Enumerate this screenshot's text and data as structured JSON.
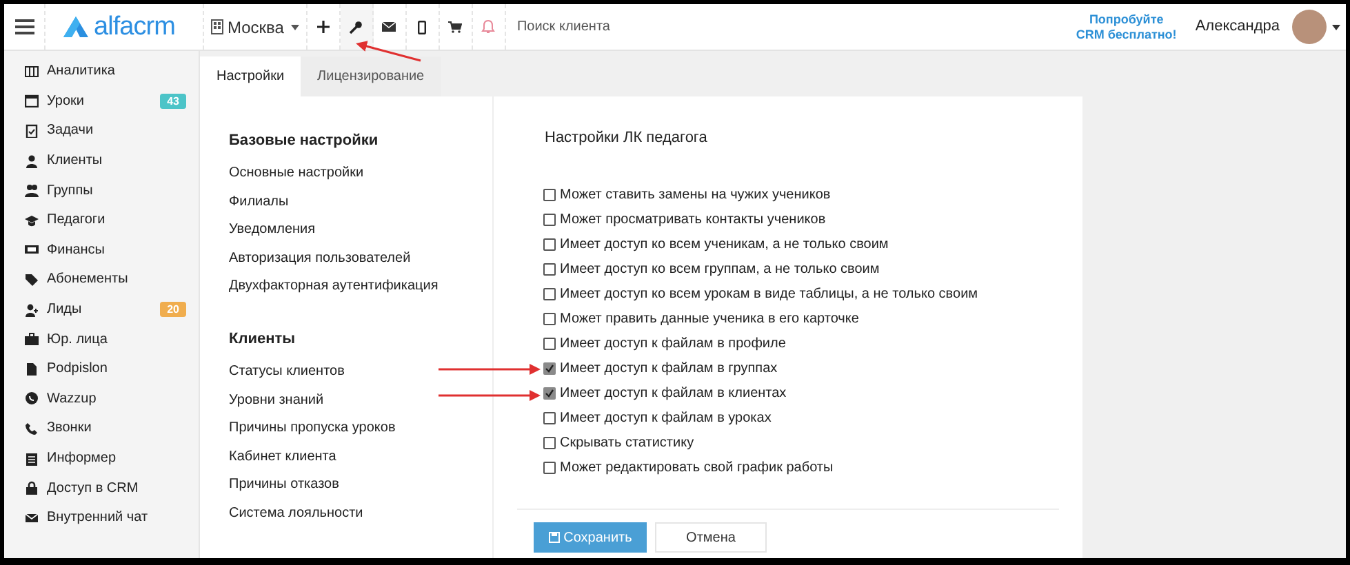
{
  "header": {
    "logo": "alfacrm",
    "branch": "Москва",
    "search": {
      "placeholder": "Поиск клиента"
    },
    "promo": "Попробуйте CRM бесплатно!",
    "user": "Александра"
  },
  "sidebar": {
    "items": [
      {
        "label": "Аналитика"
      },
      {
        "label": "Уроки",
        "badge": "43",
        "color": "#4cc4c8"
      },
      {
        "label": "Задачи"
      },
      {
        "label": "Клиенты"
      },
      {
        "label": "Группы"
      },
      {
        "label": "Педагоги"
      },
      {
        "label": "Финансы"
      },
      {
        "label": "Абонементы"
      },
      {
        "label": "Лиды",
        "badge": "20",
        "color": "#f0ad4e"
      },
      {
        "label": "Юр. лица"
      },
      {
        "label": "Podpislon"
      },
      {
        "label": "Wazzup"
      },
      {
        "label": "Звонки"
      },
      {
        "label": "Информер"
      },
      {
        "label": "Доступ в CRM"
      },
      {
        "label": "Внутренний чат"
      }
    ]
  },
  "tabs": [
    {
      "label": "Настройки",
      "selected": true
    },
    {
      "label": "Лицензирование",
      "selected": false
    }
  ],
  "settings_menu": {
    "sections": [
      {
        "title": "Базовые настройки",
        "items": [
          "Основные настройки",
          "Филиалы",
          "Уведомления",
          "Авторизация пользователей",
          "Двухфакторная аутентификация"
        ]
      },
      {
        "title": "Клиенты",
        "items": [
          "Статусы клиентов",
          "Уровни знаний",
          "Причины пропуска уроков",
          "Кабинет клиента",
          "Причины отказов",
          "Система лояльности"
        ]
      }
    ]
  },
  "teacher_settings": {
    "title": "Настройки ЛК педагога",
    "options": [
      {
        "label": "Может ставить замены на чужих учеников",
        "checked": false
      },
      {
        "label": "Может просматривать контакты учеников",
        "checked": false
      },
      {
        "label": "Имеет доступ ко всем ученикам, а не только своим",
        "checked": false
      },
      {
        "label": "Имеет доступ ко всем группам, а не только своим",
        "checked": false
      },
      {
        "label": "Имеет доступ ко всем урокам в виде таблицы, а не только своим",
        "checked": false
      },
      {
        "label": "Может править данные ученика в его карточке",
        "checked": false
      },
      {
        "label": "Имеет доступ к файлам в профиле",
        "checked": false
      },
      {
        "label": "Имеет доступ к файлам в группах",
        "checked": true
      },
      {
        "label": "Имеет доступ к файлам в клиентах",
        "checked": true
      },
      {
        "label": "Имеет доступ к файлам в уроках",
        "checked": false
      },
      {
        "label": "Скрывать статистику",
        "checked": false
      },
      {
        "label": "Может редактировать свой график работы",
        "checked": false
      }
    ]
  },
  "buttons": {
    "save": "Сохранить",
    "cancel": "Отмена"
  }
}
